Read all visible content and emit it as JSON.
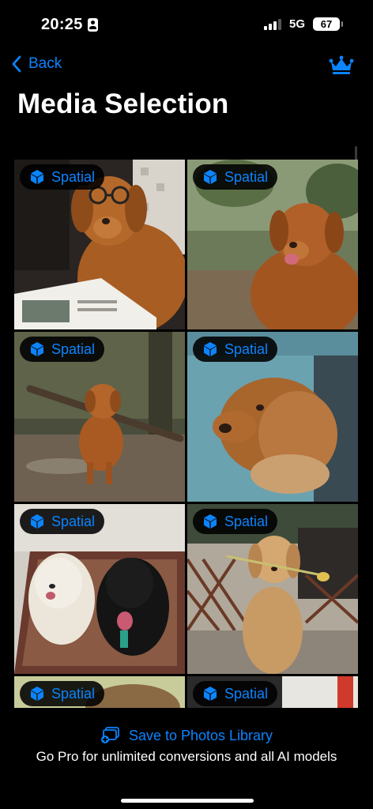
{
  "status_bar": {
    "time": "20:25",
    "network": "5G",
    "battery": "67"
  },
  "nav": {
    "back_label": "Back"
  },
  "page": {
    "title": "Media Selection"
  },
  "grid": {
    "items": [
      {
        "badge": "Spatial"
      },
      {
        "badge": "Spatial"
      },
      {
        "badge": "Spatial"
      },
      {
        "badge": "Spatial"
      },
      {
        "badge": "Spatial"
      },
      {
        "badge": "Spatial"
      },
      {
        "badge": "Spatial"
      },
      {
        "badge": "Spatial"
      }
    ]
  },
  "footer": {
    "save_label": "Save to Photos Library",
    "promo_text": "Go Pro for unlimited conversions and all AI models"
  },
  "colors": {
    "accent": "#0a84ff",
    "background": "#000000"
  }
}
